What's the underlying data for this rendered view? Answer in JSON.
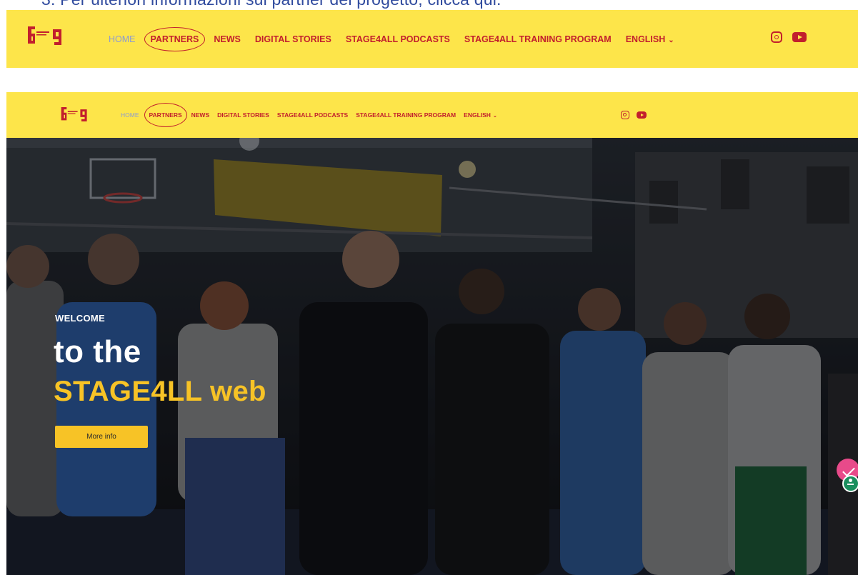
{
  "document_text": "3.  Per ulteriori informazioni sui partner del progetto, clicca qui.",
  "colors": {
    "nav_bg": "#fde54a",
    "nav_link": "#c21f2d",
    "nav_home": "#8d9bd0",
    "hero_accent": "#f7c326",
    "doc_text": "#2f4a9e"
  },
  "nav": {
    "logo_icon": "stage4all-logo-icon",
    "items": [
      {
        "label": "HOME",
        "state": "inactive"
      },
      {
        "label": "PARTNERS",
        "state": "circled"
      },
      {
        "label": "NEWS"
      },
      {
        "label": "DIGITAL STORIES"
      },
      {
        "label": "STAGE4ALL PODCASTS"
      },
      {
        "label": "STAGE4ALL TRAINING PROGRAM"
      },
      {
        "label": "ENGLISH",
        "dropdown": true
      }
    ],
    "social_icons": [
      "instagram-icon",
      "youtube-icon"
    ]
  },
  "nav2": {
    "items": [
      {
        "label": "HOME"
      },
      {
        "label": "PARTNERS"
      },
      {
        "label": "NEWS"
      },
      {
        "label": "DIGITAL STORIES"
      },
      {
        "label": "STAGE4ALL PODCASTS"
      },
      {
        "label": "STAGE4ALL TRAINING PROGRAM"
      },
      {
        "label": "ENGLISH"
      }
    ]
  },
  "hero": {
    "welcome": "WELCOME",
    "title_line1": "to the",
    "title_line2": "STAGE4LL web",
    "button_label": "More info"
  },
  "floating": {
    "icons": [
      "pink-action-icon",
      "accessibility-icon"
    ]
  }
}
